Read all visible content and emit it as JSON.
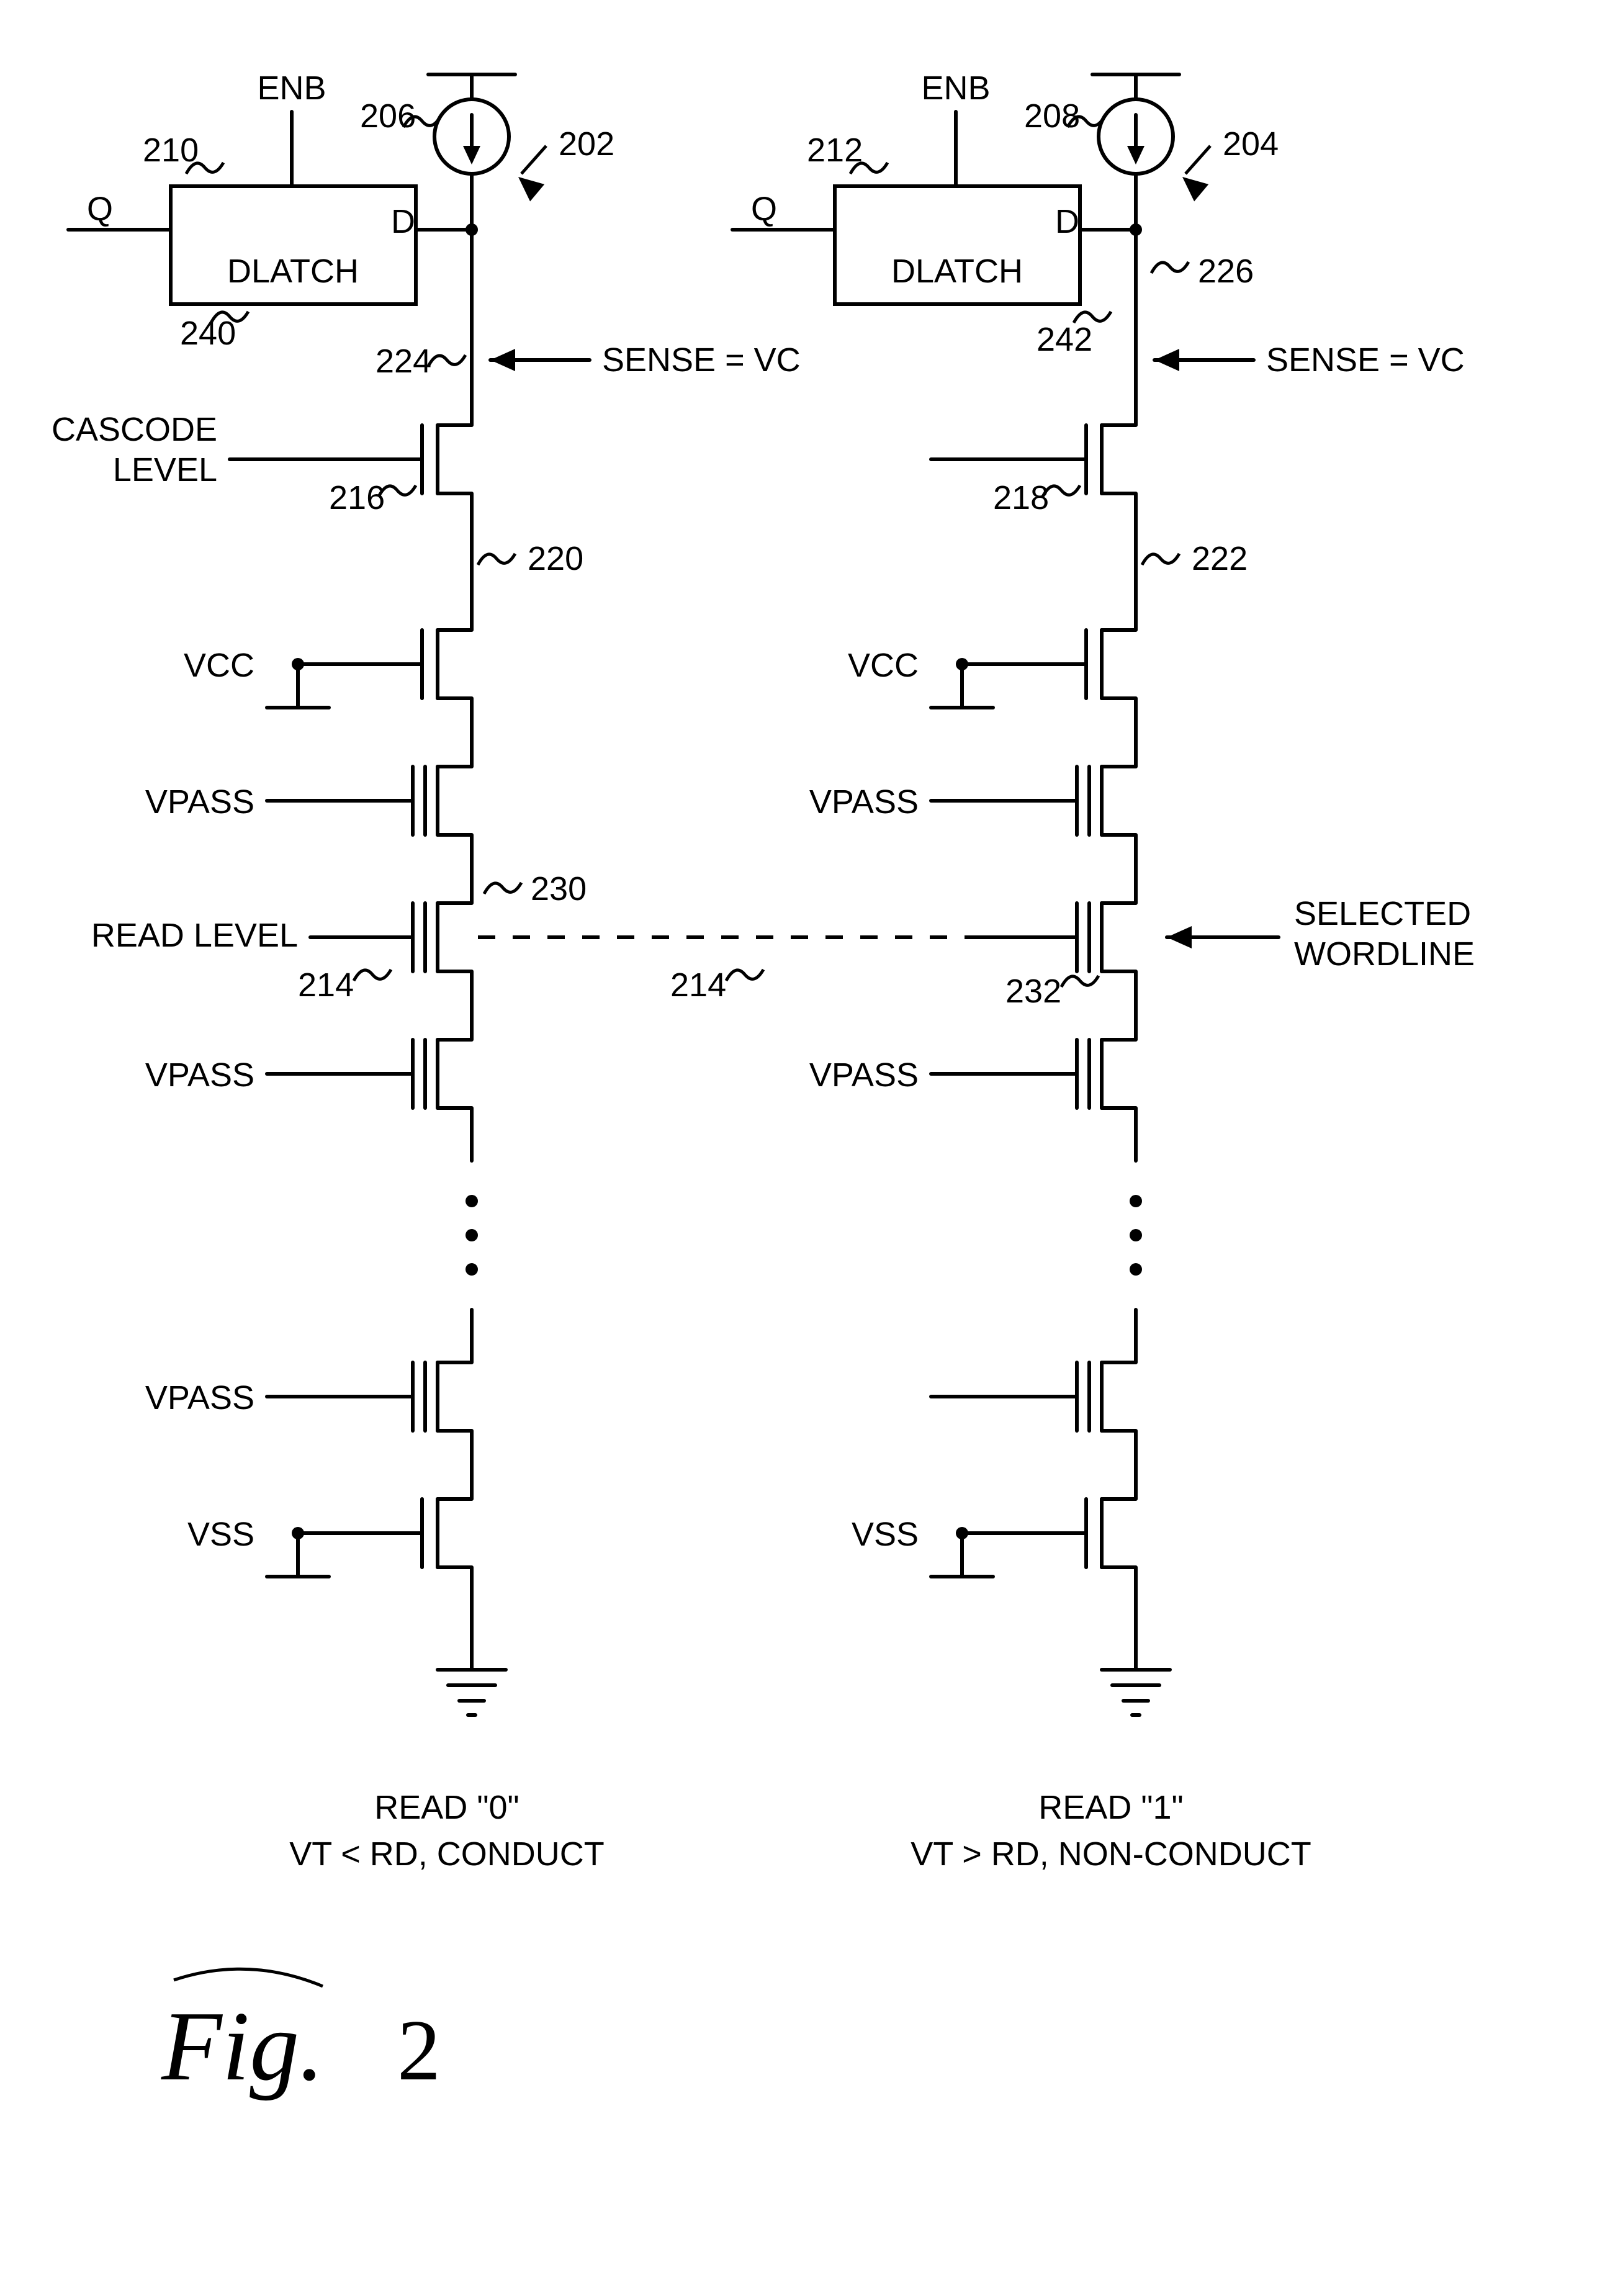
{
  "labels": {
    "ENB": "ENB",
    "Q": "Q",
    "D": "D",
    "DLATCH": "DLATCH",
    "SENSE": "SENSE = VC",
    "CASCODE": "CASCODE",
    "LEVEL": "LEVEL",
    "VCC": "VCC",
    "VPASS": "VPASS",
    "READ_LEVEL": "READ LEVEL",
    "VSS": "VSS",
    "SELECTED": "SELECTED",
    "WORDLINE": "WORDLINE",
    "READ0_TITLE": "READ \"0\"",
    "READ0_SUB": "VT < RD, CONDUCT",
    "READ1_TITLE": "READ \"1\"",
    "READ1_SUB": "VT > RD, NON-CONDUCT",
    "FIG": "Fig.",
    "FIGNUM": "2"
  },
  "refs": {
    "r202": "202",
    "r204": "204",
    "r206": "206",
    "r208": "208",
    "r210": "210",
    "r212": "212",
    "r214a": "214",
    "r214b": "214",
    "r216": "216",
    "r218": "218",
    "r220": "220",
    "r222": "222",
    "r224": "224",
    "r226": "226",
    "r230": "230",
    "r232": "232",
    "r240": "240",
    "r242": "242"
  }
}
